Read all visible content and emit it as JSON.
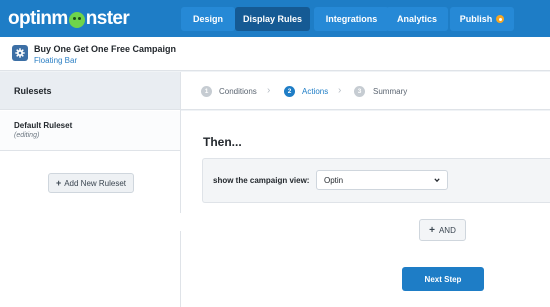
{
  "brand": {
    "logo_pre": "optinm",
    "logo_post": "nster"
  },
  "nav": [
    {
      "label": "Design",
      "active": false
    },
    {
      "label": "Display Rules",
      "active": true
    },
    {
      "label": "Integrations",
      "active": false
    },
    {
      "label": "Analytics",
      "active": false
    },
    {
      "label": "Publish",
      "active": false
    }
  ],
  "campaign": {
    "title": "Buy One Get One Free Campaign",
    "type": "Floating Bar"
  },
  "sidebar": {
    "heading": "Rulesets",
    "rulesets": [
      {
        "name": "Default Ruleset",
        "status": "(editing)"
      }
    ],
    "add_button": "Add New Ruleset"
  },
  "steps": [
    {
      "num": "1",
      "label": "Conditions",
      "active": false
    },
    {
      "num": "2",
      "label": "Actions",
      "active": true
    },
    {
      "num": "3",
      "label": "Summary",
      "active": false
    }
  ],
  "main": {
    "heading": "Then...",
    "rule_label": "show the campaign view:",
    "select_value": "Optin",
    "and_button": "AND",
    "next_button": "Next Step"
  },
  "colors": {
    "primary": "#1e7dc6",
    "nav_active": "#155a94",
    "publish_badge": "#f5a623",
    "mascot": "#6fd44b"
  },
  "icons": {
    "campaign": "gear-icon",
    "add": "plus-icon",
    "select": "chevron-down-icon",
    "step_separator": "chevron-right-icon",
    "collapse": "chevron-left-icon"
  }
}
